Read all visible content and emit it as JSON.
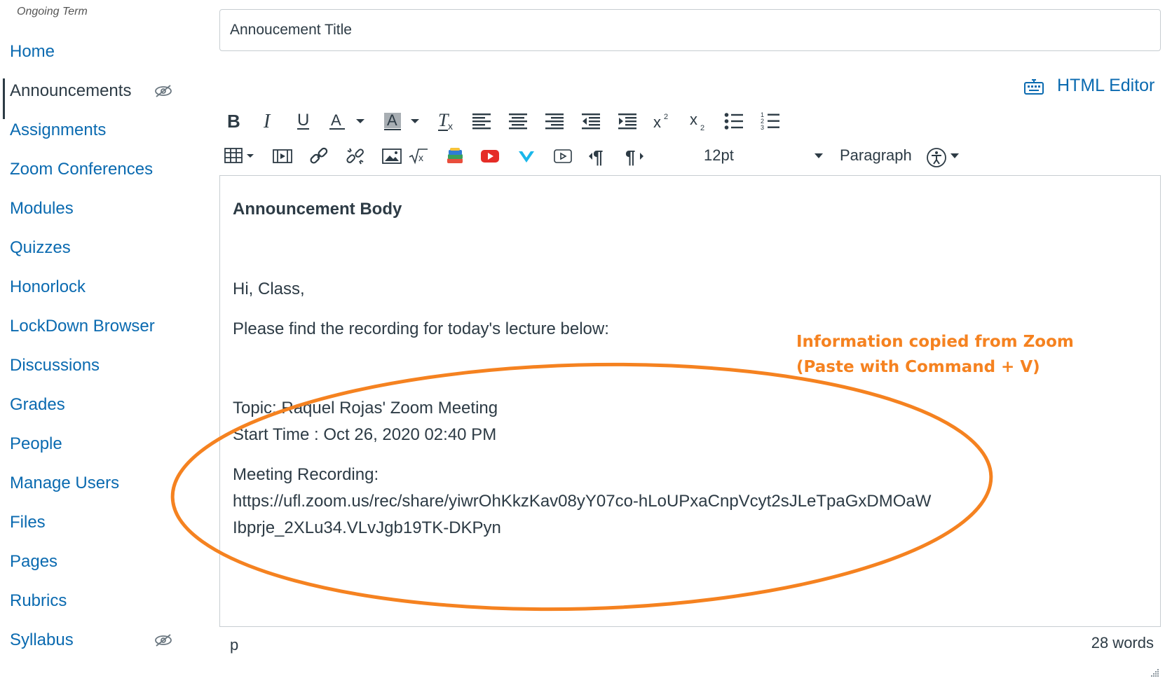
{
  "sidebar": {
    "term_label": "Ongoing Term",
    "items": [
      {
        "label": "Home"
      },
      {
        "label": "Announcements"
      },
      {
        "label": "Assignments"
      },
      {
        "label": "Zoom Conferences"
      },
      {
        "label": "Modules"
      },
      {
        "label": "Quizzes"
      },
      {
        "label": "Honorlock"
      },
      {
        "label": "LockDown Browser"
      },
      {
        "label": "Discussions"
      },
      {
        "label": "Grades"
      },
      {
        "label": "People"
      },
      {
        "label": "Manage Users"
      },
      {
        "label": "Files"
      },
      {
        "label": "Pages"
      },
      {
        "label": "Rubrics"
      },
      {
        "label": "Syllabus"
      }
    ],
    "active_item": "Announcements",
    "hidden_icon": "eye-slash-icon"
  },
  "title_field": {
    "value": "Annoucement Title"
  },
  "html_editor_link": {
    "label": "HTML Editor",
    "icon": "keyboard-icon"
  },
  "toolbar": {
    "row1_icons": [
      "bold-icon",
      "italic-icon",
      "underline-icon",
      "text-color-icon",
      "background-color-icon",
      "clear-formatting-icon",
      "align-left-icon",
      "align-center-icon",
      "align-right-icon",
      "outdent-icon",
      "indent-icon",
      "superscript-icon",
      "subscript-icon",
      "bullet-list-icon",
      "numbered-list-icon"
    ],
    "row2_icons": [
      "table-icon",
      "media-icon",
      "link-icon",
      "unlink-icon",
      "image-icon",
      "equation-icon",
      "apps-icon",
      "youtube-icon",
      "vimeo-icon",
      "video-icon",
      "ltr-icon",
      "rtl-icon",
      "accessibility-icon"
    ],
    "font_size": "12pt",
    "block_format": "Paragraph"
  },
  "editor": {
    "heading": "Announcement Body",
    "greeting": "Hi, Class,",
    "intro": "Please find the recording for today's lecture below:",
    "topic": "Topic: Raquel Rojas' Zoom Meeting",
    "start_time": "Start Time : Oct 26, 2020 02:40 PM",
    "recording_label": "Meeting Recording:",
    "recording_url_line1": "https://ufl.zoom.us/rec/share/yiwrOhKkzKav08yY07co-hLoUPxaCnpVcyt2sJLeTpaGxDMOaW",
    "recording_url_line2": "Ibprje_2XLu34.VLvJgb19TK-DKPyn"
  },
  "annotation": {
    "line1": "Information copied from Zoom",
    "line2": "(Paste with Command + V)",
    "color": "#f58220"
  },
  "status_bar": {
    "element_path": "p",
    "word_count": "28 words"
  }
}
